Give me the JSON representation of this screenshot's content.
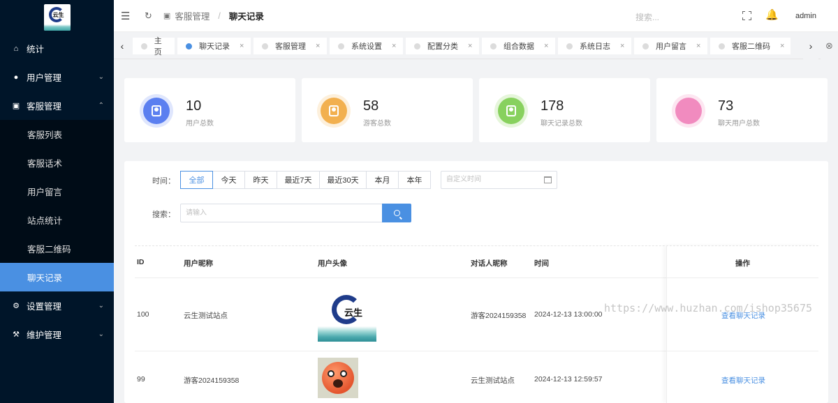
{
  "sidebar": {
    "logo_text": "云生",
    "items": [
      {
        "label": "统计",
        "icon": "home-icon"
      },
      {
        "label": "用户管理",
        "icon": "user-icon"
      },
      {
        "label": "客服管理",
        "icon": "chat-icon"
      },
      {
        "label": "设置管理",
        "icon": "gear-icon"
      },
      {
        "label": "维护管理",
        "icon": "wrench-icon"
      }
    ],
    "submenu": [
      "客服列表",
      "客服话术",
      "用户留言",
      "站点统计",
      "客服二维码",
      "聊天记录"
    ],
    "active_sub": "聊天记录"
  },
  "header": {
    "breadcrumb_parent": "客服管理",
    "breadcrumb_current": "聊天记录",
    "search_placeholder": "搜索...",
    "user": "admin"
  },
  "tabs": [
    "主页",
    "聊天记录",
    "客服管理",
    "系统设置",
    "配置分类",
    "组合数据",
    "系统日志",
    "用户留言",
    "客服二维码"
  ],
  "stats": [
    {
      "value": "10",
      "label": "用户总数",
      "color": "#5b7ff0",
      "ring": "#dfe6fd"
    },
    {
      "value": "58",
      "label": "游客总数",
      "color": "#f2b04f",
      "ring": "#fdf0dc"
    },
    {
      "value": "178",
      "label": "聊天记录总数",
      "color": "#88d15e",
      "ring": "#e6f6db"
    },
    {
      "value": "73",
      "label": "聊天用户总数",
      "color": "#f18bbf",
      "ring": "#fde6f1"
    }
  ],
  "filter": {
    "time_label": "时间：",
    "time_options": [
      "全部",
      "今天",
      "昨天",
      "最近7天",
      "最近30天",
      "本月",
      "本年"
    ],
    "selected": "全部",
    "date_placeholder": "自定义时间",
    "search_label": "搜索：",
    "search_placeholder": "请输入"
  },
  "table": {
    "headers": [
      "ID",
      "用户昵称",
      "用户头像",
      "对话人昵称",
      "时间",
      "操作"
    ],
    "rows": [
      {
        "id": "100",
        "nickname": "云生测试站点",
        "peer": "游客2024159358",
        "time": "2024-12-13 13:00:00",
        "action": "查看聊天记录"
      },
      {
        "id": "99",
        "nickname": "游客2024159358",
        "peer": "云生测试站点",
        "time": "2024-12-13 12:59:57",
        "action": "查看聊天记录"
      }
    ]
  },
  "watermark": "https://www.huzhan.com/ishop35675"
}
